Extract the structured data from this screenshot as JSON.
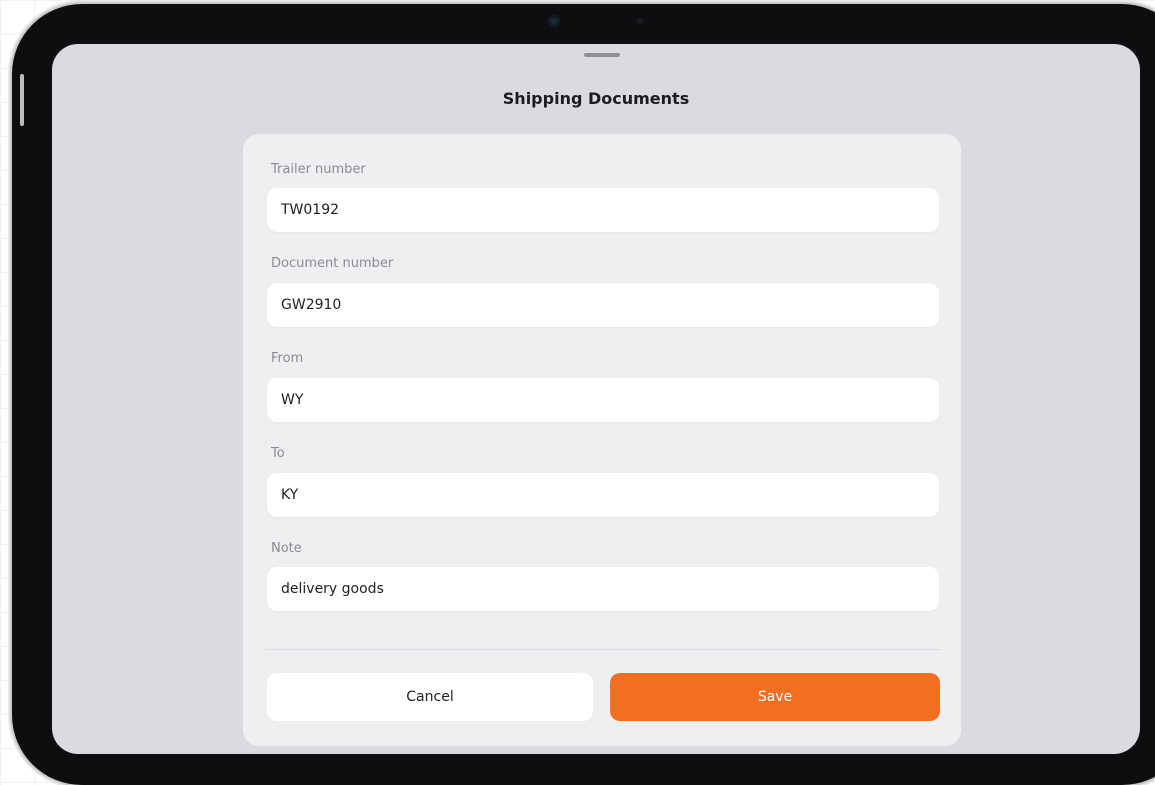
{
  "sheet": {
    "title": "Shipping Documents"
  },
  "form": {
    "fields": [
      {
        "label": "Trailer number",
        "value": "TW0192"
      },
      {
        "label": "Document number",
        "value": "GW2910"
      },
      {
        "label": "From",
        "value": "WY"
      },
      {
        "label": "To",
        "value": "KY"
      },
      {
        "label": "Note",
        "value": "delivery goods"
      }
    ]
  },
  "actions": {
    "cancel_label": "Cancel",
    "save_label": "Save"
  },
  "colors": {
    "accent": "#f26f21",
    "screen_background": "#dadbde",
    "card_background": "#eeeff1"
  }
}
